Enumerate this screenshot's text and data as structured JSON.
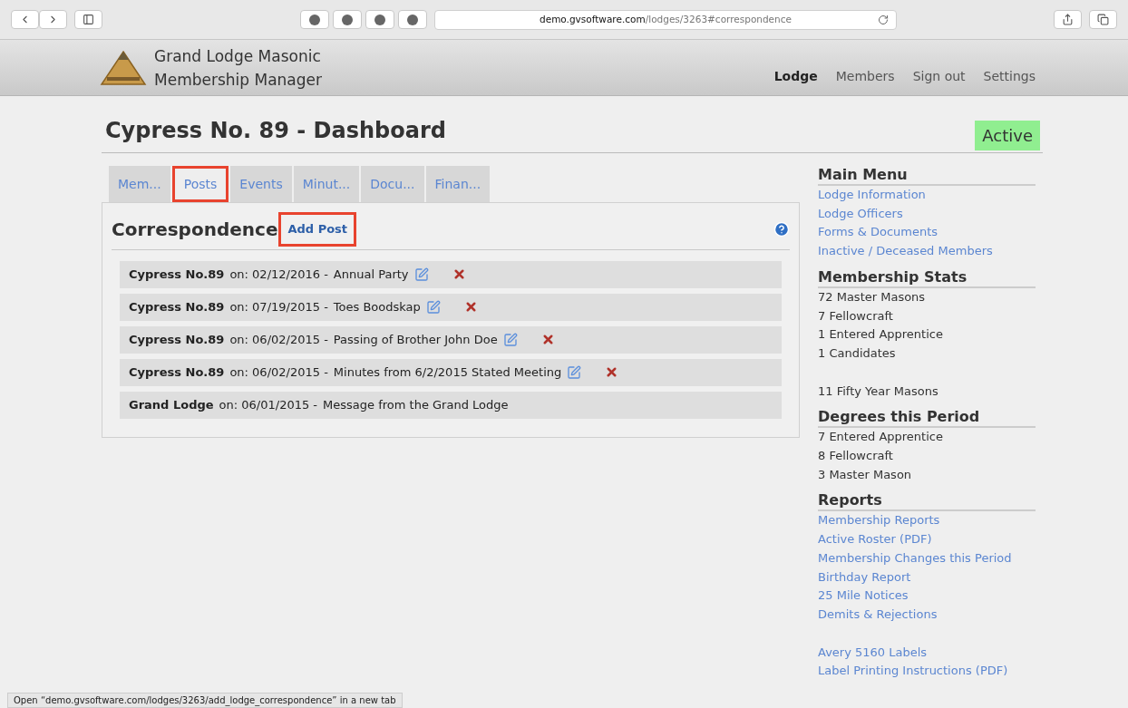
{
  "browser": {
    "url_domain": "demo.gvsoftware.com",
    "url_path": "/lodges/3263#correspondence"
  },
  "header": {
    "title_lines": [
      "Grand Lodge Masonic",
      "Membership Manager"
    ],
    "nav": [
      {
        "label": "Lodge",
        "selected": true
      },
      {
        "label": "Members",
        "selected": false
      },
      {
        "label": "Sign out",
        "selected": false
      },
      {
        "label": "Settings",
        "selected": false
      }
    ]
  },
  "page": {
    "title": "Cypress No. 89 - Dashboard",
    "status": "Active"
  },
  "tabs": [
    {
      "label": "Mem...",
      "selected": false,
      "highlighted": false
    },
    {
      "label": "Posts",
      "selected": true,
      "highlighted": true
    },
    {
      "label": "Events",
      "selected": false,
      "highlighted": false
    },
    {
      "label": "Minut...",
      "selected": false,
      "highlighted": false
    },
    {
      "label": "Docu...",
      "selected": false,
      "highlighted": false
    },
    {
      "label": "Finan...",
      "selected": false,
      "highlighted": false
    }
  ],
  "panel": {
    "title": "Correspondence",
    "add_link": "Add Post",
    "add_highlighted": true
  },
  "posts": [
    {
      "author": "Cypress No.89",
      "date": "on: 02/12/2016 -",
      "title": "Annual Party",
      "editable": true
    },
    {
      "author": "Cypress No.89",
      "date": "on: 07/19/2015 -",
      "title": "Toes Boodskap",
      "editable": true
    },
    {
      "author": "Cypress No.89",
      "date": "on: 06/02/2015 -",
      "title": "Passing of Brother John Doe",
      "editable": true
    },
    {
      "author": "Cypress No.89",
      "date": "on: 06/02/2015 -",
      "title": "Minutes from 6/2/2015 Stated Meeting",
      "editable": true
    },
    {
      "author": "Grand Lodge",
      "date": "on: 06/01/2015 -",
      "title": "Message from the Grand Lodge",
      "editable": false
    }
  ],
  "sidebar": [
    {
      "heading": "Main Menu",
      "groups": [
        [
          {
            "kind": "link",
            "text": "Lodge Information"
          },
          {
            "kind": "link",
            "text": "Lodge Officers"
          },
          {
            "kind": "link",
            "text": "Forms & Documents"
          },
          {
            "kind": "link",
            "text": "Inactive / Deceased Members"
          }
        ]
      ]
    },
    {
      "heading": "Membership Stats",
      "groups": [
        [
          {
            "kind": "text",
            "text": "72 Master Masons"
          },
          {
            "kind": "text",
            "text": "7 Fellowcraft"
          },
          {
            "kind": "text",
            "text": "1 Entered Apprentice"
          },
          {
            "kind": "text",
            "text": "1 Candidates"
          }
        ],
        [
          {
            "kind": "text",
            "text": "11 Fifty Year Masons"
          }
        ]
      ]
    },
    {
      "heading": "Degrees this Period",
      "groups": [
        [
          {
            "kind": "text",
            "text": "7 Entered Apprentice"
          },
          {
            "kind": "text",
            "text": "8 Fellowcraft"
          },
          {
            "kind": "text",
            "text": "3 Master Mason"
          }
        ]
      ]
    },
    {
      "heading": "Reports",
      "groups": [
        [
          {
            "kind": "link",
            "text": "Membership Reports"
          },
          {
            "kind": "link",
            "text": "Active Roster (PDF)"
          },
          {
            "kind": "link",
            "text": "Membership Changes this Period"
          },
          {
            "kind": "link",
            "text": "Birthday Report"
          },
          {
            "kind": "link",
            "text": "25 Mile Notices"
          },
          {
            "kind": "link",
            "text": "Demits & Rejections"
          }
        ],
        [
          {
            "kind": "link",
            "text": "Avery 5160 Labels"
          },
          {
            "kind": "link",
            "text": "Label Printing Instructions (PDF)"
          }
        ]
      ]
    }
  ],
  "status_bar": "Open “demo.gvsoftware.com/lodges/3263/add_lodge_correspondence” in a new tab"
}
